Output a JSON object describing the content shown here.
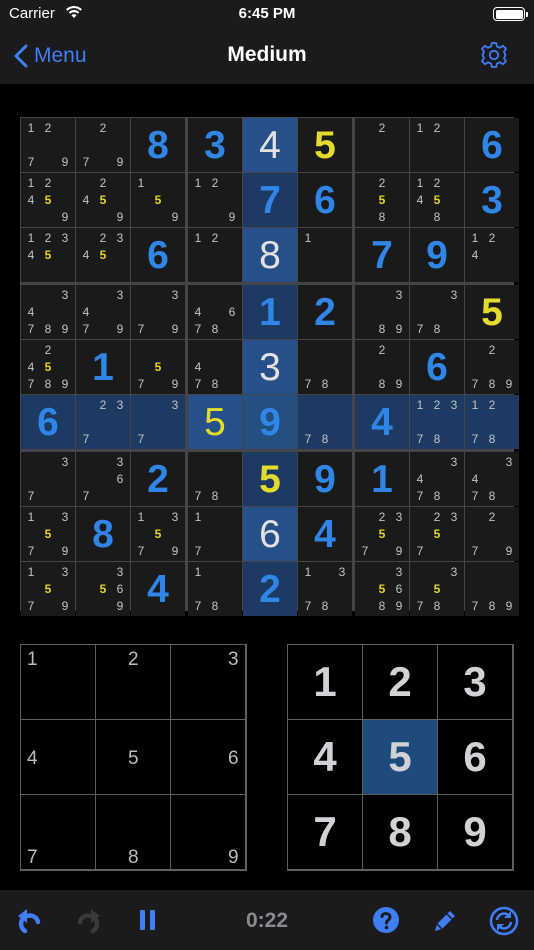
{
  "status_bar": {
    "carrier": "Carrier",
    "time": "6:45 PM"
  },
  "nav": {
    "back_label": "Menu",
    "title": "Medium"
  },
  "colors": {
    "accent": "#3f7ef5",
    "entered_digit": "#2f86e6",
    "yellow_digit": "#e4dc2c",
    "highlight": "#1c3a62",
    "selected": "#244f81"
  },
  "board": {
    "selected_cell": [
      5,
      4
    ],
    "rows": [
      [
        {
          "n": [
            1,
            2,
            7,
            9
          ]
        },
        {
          "n": [
            2,
            7,
            9
          ]
        },
        {
          "v": 8,
          "k": "e"
        },
        {
          "v": 3,
          "k": "e"
        },
        {
          "v": 4,
          "k": "g"
        },
        {
          "v": 5,
          "k": "y"
        },
        {
          "n": [
            2
          ]
        },
        {
          "n": [
            1,
            2
          ]
        },
        {
          "v": 6,
          "k": "e"
        }
      ],
      [
        {
          "n": [
            1,
            2,
            4,
            5,
            9
          ],
          "h": [
            5
          ]
        },
        {
          "n": [
            2,
            4,
            5,
            9
          ],
          "h": [
            5
          ]
        },
        {
          "n": [
            1,
            5,
            9
          ],
          "h": [
            5
          ]
        },
        {
          "n": [
            1,
            2,
            9
          ]
        },
        {
          "v": 7,
          "k": "e"
        },
        {
          "v": 6,
          "k": "e"
        },
        {
          "n": [
            2,
            5,
            8
          ],
          "h": [
            5
          ]
        },
        {
          "n": [
            1,
            2,
            4,
            5,
            8
          ],
          "h": [
            5
          ]
        },
        {
          "v": 3,
          "k": "e"
        }
      ],
      [
        {
          "n": [
            1,
            2,
            3,
            4,
            5
          ],
          "h": [
            5
          ]
        },
        {
          "n": [
            2,
            3,
            4,
            5
          ],
          "h": [
            5
          ]
        },
        {
          "v": 6,
          "k": "e"
        },
        {
          "n": [
            1,
            2
          ]
        },
        {
          "v": 8,
          "k": "g"
        },
        {
          "n": [
            1
          ]
        },
        {
          "v": 7,
          "k": "e"
        },
        {
          "v": 9,
          "k": "e"
        },
        {
          "n": [
            1,
            2,
            4
          ]
        }
      ],
      [
        {
          "n": [
            3,
            4,
            7,
            8,
            9
          ]
        },
        {
          "n": [
            3,
            4,
            7,
            9
          ]
        },
        {
          "n": [
            3,
            7,
            9
          ]
        },
        {
          "n": [
            4,
            6,
            7,
            8
          ]
        },
        {
          "v": 1,
          "k": "e"
        },
        {
          "v": 2,
          "k": "e"
        },
        {
          "n": [
            3,
            8,
            9
          ]
        },
        {
          "n": [
            3,
            7,
            8
          ]
        },
        {
          "v": 5,
          "k": "y"
        }
      ],
      [
        {
          "n": [
            2,
            4,
            5,
            7,
            8,
            9
          ],
          "h": [
            5
          ]
        },
        {
          "v": 1,
          "k": "e"
        },
        {
          "n": [
            5,
            7,
            9
          ],
          "h": [
            5
          ]
        },
        {
          "n": [
            4,
            7,
            8
          ]
        },
        {
          "v": 3,
          "k": "g"
        },
        {
          "n": [
            7,
            8
          ]
        },
        {
          "n": [
            2,
            8,
            9
          ]
        },
        {
          "v": 6,
          "k": "e"
        },
        {
          "n": [
            2,
            7,
            8,
            9
          ]
        }
      ],
      [
        {
          "v": 6,
          "k": "e"
        },
        {
          "n": [
            2,
            3,
            7
          ]
        },
        {
          "n": [
            3,
            7
          ]
        },
        {
          "v": 5,
          "k": "y",
          "g": true
        },
        {
          "v": 9,
          "k": "e"
        },
        {
          "n": [
            7,
            8
          ]
        },
        {
          "v": 4,
          "k": "e"
        },
        {
          "n": [
            1,
            2,
            3,
            7,
            8
          ]
        },
        {
          "n": [
            1,
            2,
            7,
            8
          ]
        }
      ],
      [
        {
          "n": [
            3,
            7
          ]
        },
        {
          "n": [
            3,
            6,
            7
          ]
        },
        {
          "v": 2,
          "k": "e"
        },
        {
          "n": [
            7,
            8
          ]
        },
        {
          "v": 5,
          "k": "y"
        },
        {
          "v": 9,
          "k": "e"
        },
        {
          "v": 1,
          "k": "e"
        },
        {
          "n": [
            3,
            4,
            7,
            8
          ]
        },
        {
          "n": [
            3,
            4,
            7,
            8
          ]
        }
      ],
      [
        {
          "n": [
            1,
            3,
            5,
            7,
            9
          ],
          "h": [
            5
          ]
        },
        {
          "v": 8,
          "k": "e"
        },
        {
          "n": [
            1,
            3,
            5,
            7,
            9
          ],
          "h": [
            5
          ]
        },
        {
          "n": [
            1,
            7
          ]
        },
        {
          "v": 6,
          "k": "g"
        },
        {
          "v": 4,
          "k": "e"
        },
        {
          "n": [
            2,
            3,
            5,
            9,
            7
          ],
          "h": [
            5
          ]
        },
        {
          "n": [
            2,
            3,
            5,
            7
          ],
          "h": [
            5
          ]
        },
        {
          "n": [
            2,
            7,
            9
          ]
        }
      ],
      [
        {
          "n": [
            1,
            3,
            5,
            7,
            9
          ],
          "h": [
            5
          ]
        },
        {
          "n": [
            3,
            5,
            6,
            9
          ],
          "h": [
            5
          ]
        },
        {
          "v": 4,
          "k": "e"
        },
        {
          "n": [
            1,
            7,
            8
          ]
        },
        {
          "v": 2,
          "k": "e"
        },
        {
          "n": [
            1,
            3,
            7,
            8
          ]
        },
        {
          "n": [
            3,
            5,
            6,
            8,
            9
          ],
          "h": [
            5
          ]
        },
        {
          "n": [
            3,
            5,
            7,
            8
          ],
          "h": [
            5
          ]
        },
        {
          "n": [
            7,
            8,
            9
          ]
        }
      ]
    ]
  },
  "notes_pad": [
    "1",
    "2",
    "3",
    "4",
    "5",
    "6",
    "7",
    "8",
    "9"
  ],
  "digit_pad": {
    "digits": [
      "1",
      "2",
      "3",
      "4",
      "5",
      "6",
      "7",
      "8",
      "9"
    ],
    "active": "5"
  },
  "toolbar": {
    "timer": "0:22",
    "icons": [
      "undo-icon",
      "redo-icon",
      "pause-icon",
      "hint-icon",
      "pencil-icon",
      "restart-icon"
    ]
  }
}
